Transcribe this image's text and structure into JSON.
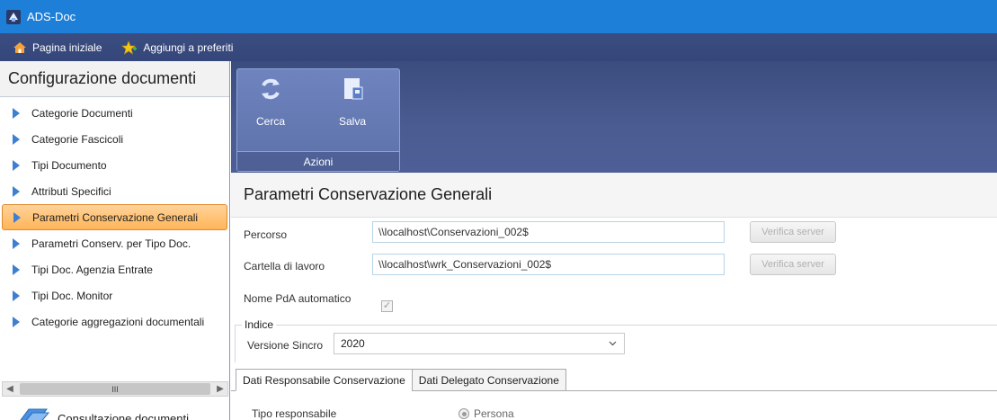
{
  "window": {
    "title": "ADS-Doc"
  },
  "favorites_bar": {
    "home_label": "Pagina iniziale",
    "add_favorite_label": "Aggiungi a preferiti"
  },
  "sidebar": {
    "header": "Configurazione documenti",
    "items": [
      {
        "label": "Categorie Documenti"
      },
      {
        "label": "Categorie Fascicoli"
      },
      {
        "label": "Tipi Documento"
      },
      {
        "label": "Attributi Specifici"
      },
      {
        "label": "Parametri Conservazione Generali"
      },
      {
        "label": "Parametri Conserv. per Tipo Doc."
      },
      {
        "label": "Tipi Doc. Agenzia Entrate"
      },
      {
        "label": "Tipi Doc. Monitor"
      },
      {
        "label": "Categorie aggregazioni documentali"
      }
    ],
    "active_index": 4,
    "scroll_thumb_glyph": "III",
    "footer_label": "Consultazione documenti"
  },
  "ribbon": {
    "group_label": "Azioni",
    "buttons": [
      {
        "label": "Cerca",
        "icon": "refresh-icon"
      },
      {
        "label": "Salva",
        "icon": "save-icon"
      }
    ]
  },
  "main": {
    "section_title": "Parametri Conservazione Generali",
    "fields": {
      "percorso_label": "Percorso",
      "percorso_value": "\\\\localhost\\Conservazioni_002$",
      "cartella_label": "Cartella di lavoro",
      "cartella_value": "\\\\localhost\\wrk_Conservazioni_002$",
      "verify_button_label": "Verifica server",
      "nome_pda_label": "Nome PdA automatico",
      "nome_pda_checked": true
    },
    "indice": {
      "group_title": "Indice",
      "version_label": "Versione Sincro",
      "version_value": "2020"
    },
    "tabs": [
      {
        "label": "Dati Responsabile Conservazione"
      },
      {
        "label": "Dati Delegato Conservazione"
      }
    ],
    "active_tab": 0,
    "tipo_responsabile_label": "Tipo responsabile",
    "tipo_responsabile_option": "Persona"
  },
  "colors": {
    "titlebar": "#1e7fd8",
    "ribbon": "#3b4c7e",
    "active_item": "#ffb558",
    "nav_triangle": "#3f7fd2"
  }
}
